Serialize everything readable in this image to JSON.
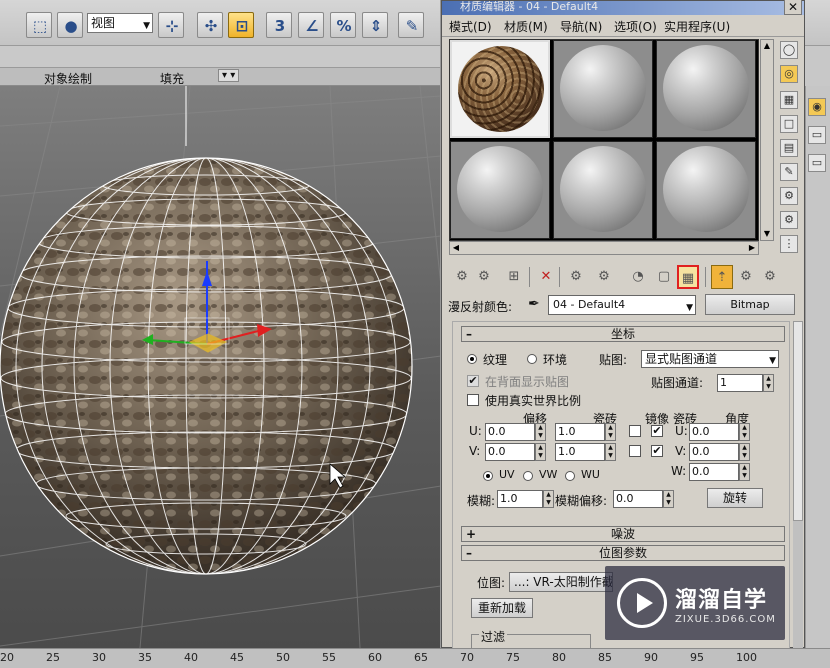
{
  "app": {
    "toolbar": {
      "view_select": "视图",
      "ribbon_items": [
        "对象绘制",
        "填充"
      ]
    },
    "timeline_ruler": [
      "20",
      "25",
      "30",
      "35",
      "40",
      "45",
      "50",
      "55",
      "60",
      "65",
      "70",
      "75",
      "80",
      "85",
      "90",
      "95",
      "100"
    ]
  },
  "material_editor": {
    "title": "材质编辑器 - 04 - Default4",
    "menu": [
      "模式(D)",
      "材质(M)",
      "导航(N)",
      "选项(O)",
      "实用程序(U)"
    ],
    "diffuse_label": "漫反射颜色:",
    "material_name": "04 - Default4",
    "map_type_button": "Bitmap",
    "coordinates": {
      "rollout_title": "坐标",
      "texture_label": "纹理",
      "environ_label": "环境",
      "mapping_label": "贴图:",
      "mapping_value": "显式贴图通道",
      "show_on_back_label": "在背面显示贴图",
      "map_channel_label": "贴图通道:",
      "map_channel_value": "1",
      "real_world_label": "使用真实世界比例",
      "col_offset": "偏移",
      "col_tiling": "瓷砖",
      "col_mirror": "镜像",
      "col_tile": "瓷砖",
      "col_angle": "角度",
      "u_label": "U:",
      "v_label": "V:",
      "w_label": "W:",
      "u_offset": "0.0",
      "v_offset": "0.0",
      "u_tiling": "1.0",
      "v_tiling": "1.0",
      "angle_u": "0.0",
      "angle_v": "0.0",
      "angle_w": "0.0",
      "uv_label": "UV",
      "vw_label": "VW",
      "wu_label": "WU",
      "blur_label": "模糊:",
      "blur_value": "1.0",
      "blur_offset_label": "模糊偏移:",
      "blur_offset_value": "0.0",
      "rotate_button": "旋转"
    },
    "noise_rollout": "噪波",
    "bitmap_params_rollout": "位图参数",
    "bitmap_label": "位图:",
    "bitmap_path": "...: VR-太阳制作截",
    "reload_button": "重新加载",
    "filter_label": "过滤"
  },
  "watermark": {
    "title": "溜溜自学",
    "subtitle": "ZIXUE.3D66.COM"
  }
}
